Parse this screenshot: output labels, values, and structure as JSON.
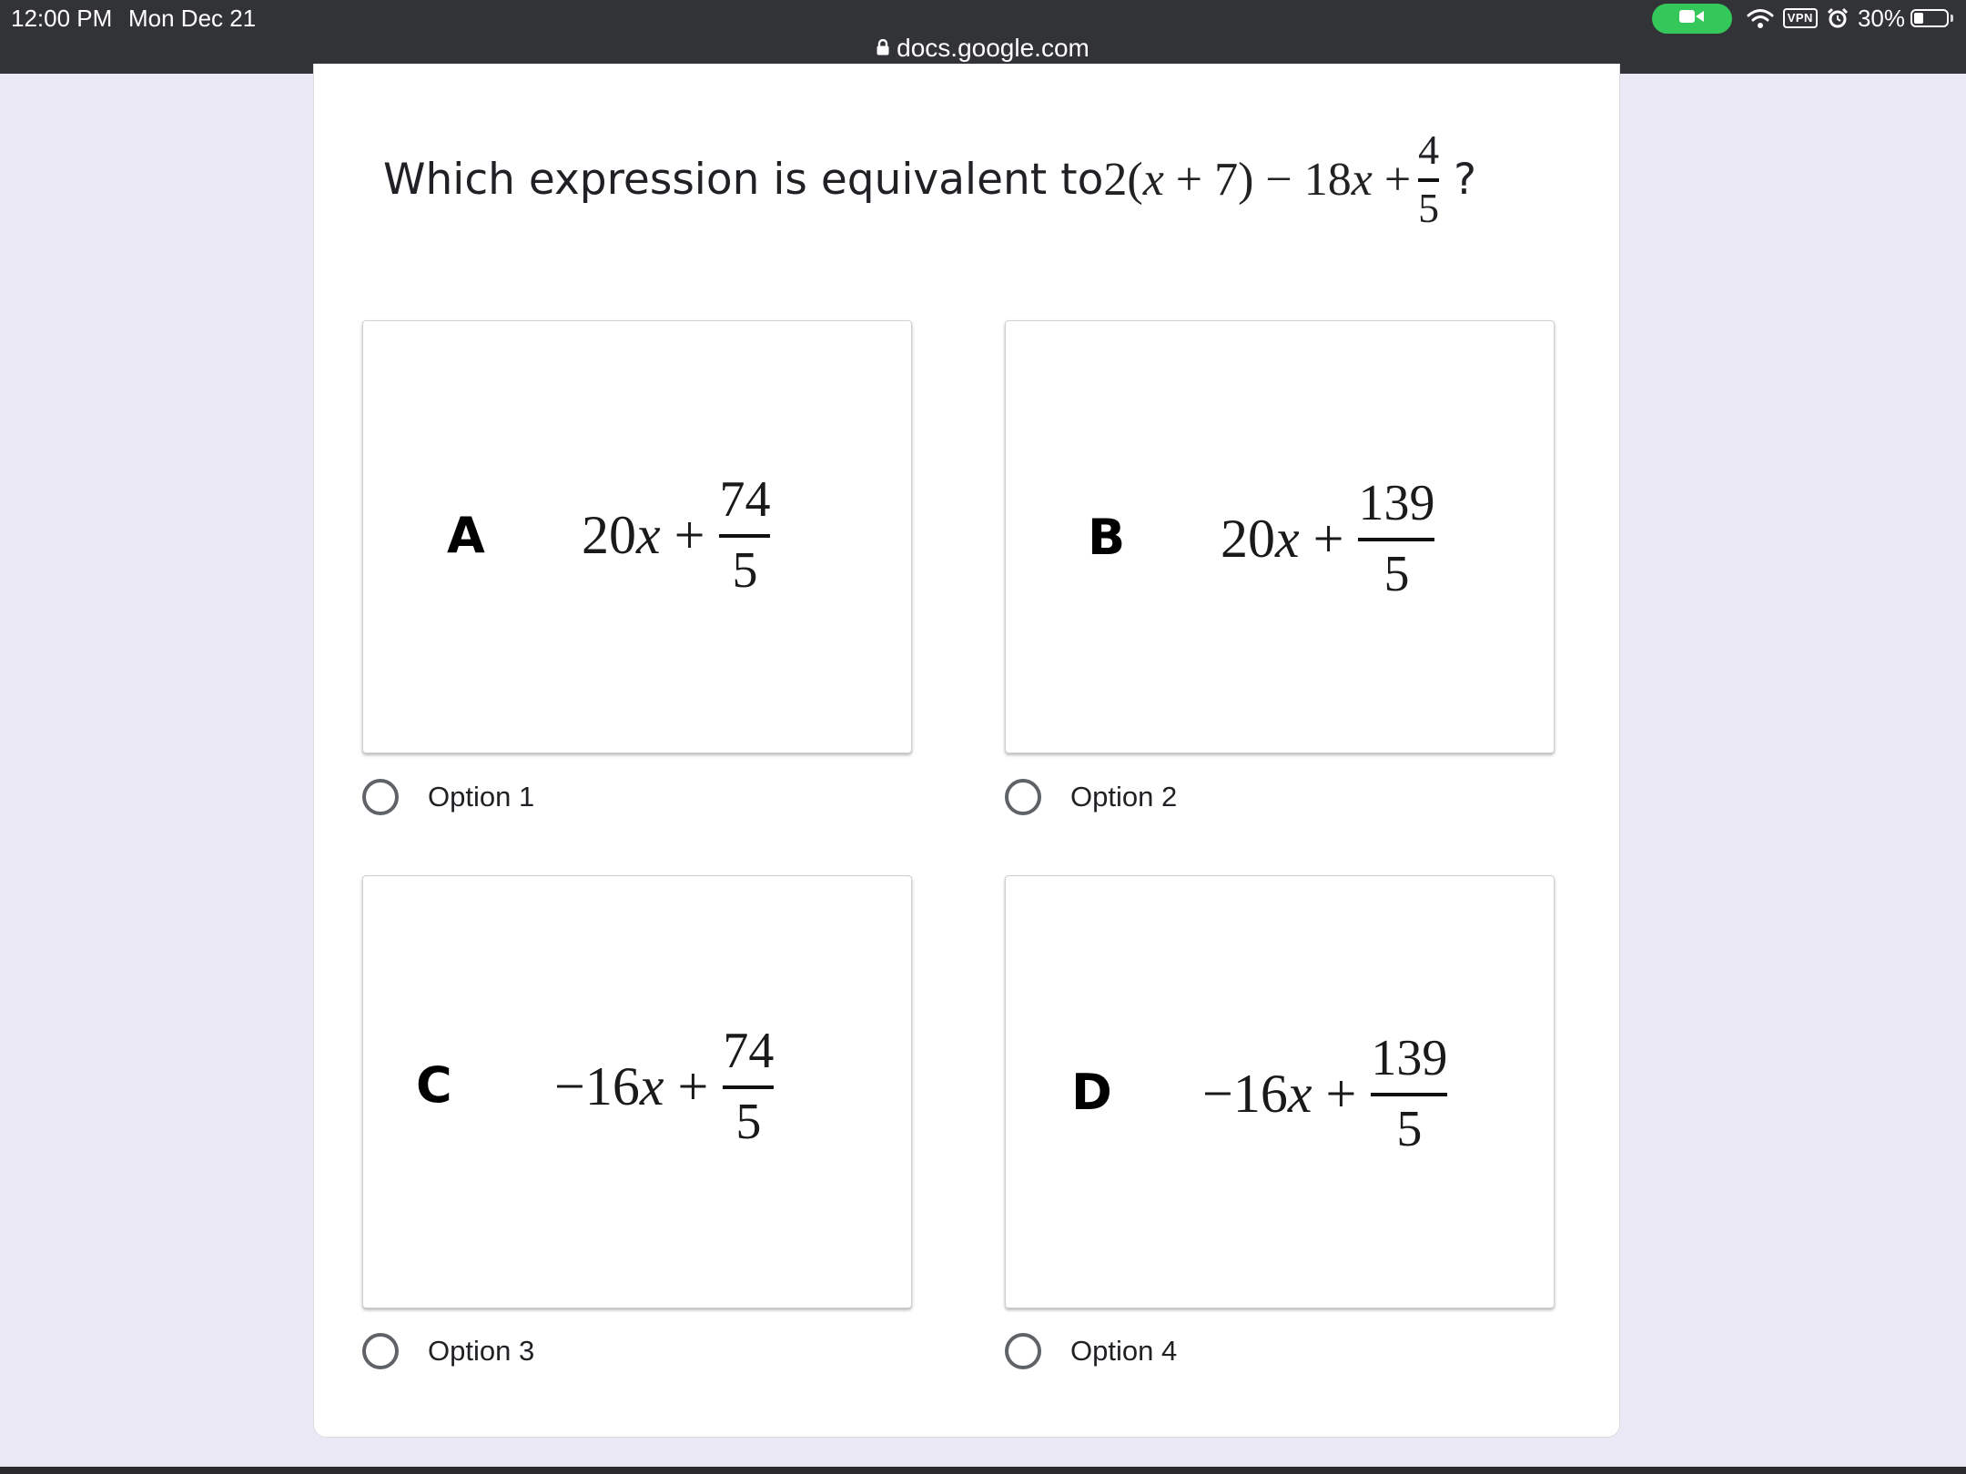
{
  "status_bar": {
    "time": "12:00 PM",
    "date": "Mon Dec 21",
    "vpn": "VPN",
    "battery_percent": "30%",
    "battery_level": 0.3,
    "camera_pill_color": "#34c759"
  },
  "address_bar": {
    "url": "docs.google.com"
  },
  "question": {
    "prefix": "Which expression is equivalent to ",
    "expr_a": "2(",
    "expr_var1": "x",
    "expr_b": " + 7) − 18",
    "expr_var2": "x",
    "expr_c": " +",
    "frac_num": "4",
    "frac_den": "5",
    "suffix": "?"
  },
  "options": [
    {
      "letter": "A",
      "coef": "20",
      "var": "x",
      "plus": " +",
      "num": "74",
      "den": "5",
      "label": "Option 1"
    },
    {
      "letter": "B",
      "coef": "20",
      "var": "x",
      "plus": " +",
      "num": "139",
      "den": "5",
      "label": "Option 2"
    },
    {
      "letter": "C",
      "coef": "−16",
      "var": "x",
      "plus": " +",
      "num": "74",
      "den": "5",
      "label": "Option 3"
    },
    {
      "letter": "D",
      "coef": "−16",
      "var": "x",
      "plus": " +",
      "num": "139",
      "den": "5",
      "label": "Option 4"
    }
  ],
  "colors": {
    "page_background": "#ece9f6",
    "topbar": "#323337",
    "radio_border": "#5f6368"
  }
}
